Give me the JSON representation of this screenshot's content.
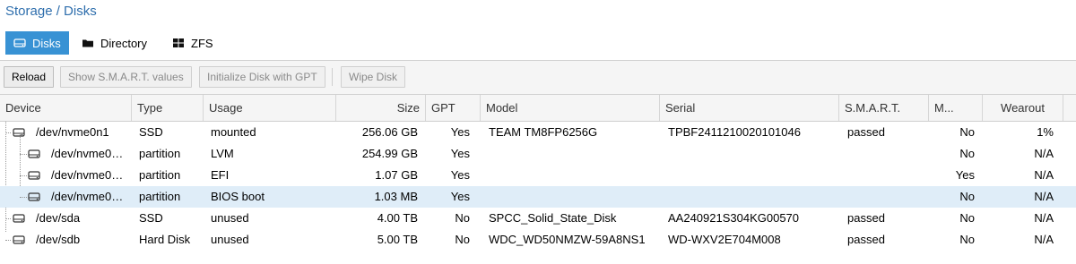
{
  "breadcrumb": "Storage / Disks",
  "tabs": [
    {
      "label": "Disks",
      "icon": "hdd-icon",
      "active": true
    },
    {
      "label": "Directory",
      "icon": "folder-icon",
      "active": false
    },
    {
      "label": "ZFS",
      "icon": "grid-icon",
      "active": false
    }
  ],
  "toolbar": {
    "reload": "Reload",
    "smart": "Show S.M.A.R.T. values",
    "init_gpt": "Initialize Disk with GPT",
    "wipe": "Wipe Disk"
  },
  "columns": {
    "device": "Device",
    "type": "Type",
    "usage": "Usage",
    "size": "Size",
    "gpt": "GPT",
    "model": "Model",
    "serial": "Serial",
    "smart": "S.M.A.R.T.",
    "mounted": "M...",
    "wearout": "Wearout"
  },
  "rows": [
    {
      "device": "/dev/nvme0n1",
      "type": "SSD",
      "usage": "mounted",
      "size": "256.06 GB",
      "gpt": "Yes",
      "model": "TEAM TM8FP6256G",
      "serial": "TPBF2411210020101046",
      "smart": "passed",
      "mounted": "No",
      "wearout": "1%"
    },
    {
      "device": "/dev/nvme0n...",
      "type": "partition",
      "usage": "LVM",
      "size": "254.99 GB",
      "gpt": "Yes",
      "model": "",
      "serial": "",
      "smart": "",
      "mounted": "No",
      "wearout": "N/A"
    },
    {
      "device": "/dev/nvme0n...",
      "type": "partition",
      "usage": "EFI",
      "size": "1.07 GB",
      "gpt": "Yes",
      "model": "",
      "serial": "",
      "smart": "",
      "mounted": "Yes",
      "wearout": "N/A"
    },
    {
      "device": "/dev/nvme0n...",
      "type": "partition",
      "usage": "BIOS boot",
      "size": "1.03 MB",
      "gpt": "Yes",
      "model": "",
      "serial": "",
      "smart": "",
      "mounted": "No",
      "wearout": "N/A"
    },
    {
      "device": "/dev/sda",
      "type": "SSD",
      "usage": "unused",
      "size": "4.00 TB",
      "gpt": "No",
      "model": "SPCC_Solid_State_Disk",
      "serial": "AA240921S304KG00570",
      "smart": "passed",
      "mounted": "No",
      "wearout": "N/A"
    },
    {
      "device": "/dev/sdb",
      "type": "Hard Disk",
      "usage": "unused",
      "size": "5.00 TB",
      "gpt": "No",
      "model": "WDC_WD50NMZW-59A8NS1",
      "serial": "WD-WXV2E704M008",
      "smart": "passed",
      "mounted": "No",
      "wearout": "N/A"
    }
  ],
  "colors": {
    "accent": "#3892d4",
    "selected_row": "#dfedf8",
    "breadcrumb": "#2f6fad"
  }
}
